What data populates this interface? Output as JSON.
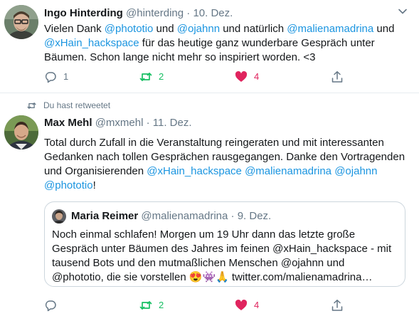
{
  "tweet1": {
    "name": "Ingo Hinterding",
    "handle": "@hinterding",
    "separator": "·",
    "date": "10. Dez.",
    "text": {
      "p1": "Vielen Dank ",
      "m1": "@phototio",
      "p2": " und ",
      "m2": "@ojahnn",
      "p3": " und natürlich ",
      "m3": "@malienamadrina",
      "p4": " und ",
      "m4": "@xHain_hackspace",
      "p5": " für das heutige ganz wunderbare Gespräch unter Bäumen. Schon lange nicht mehr so inspiriert worden. <3"
    },
    "actions": {
      "reply_count": "1",
      "retweet_count": "2",
      "like_count": "4"
    }
  },
  "tweet2": {
    "retweet_context": "Du hast retweetet",
    "name": "Max Mehl",
    "handle": "@mxmehl",
    "separator": "·",
    "date": "11. Dez.",
    "text": {
      "p1": "Total durch Zufall in die Veranstaltung reingeraten und mit interessanten Gedanken nach tollen Gesprächen rausgegangen. Danke den Vortragenden und Organisierenden ",
      "m1": "@xHain_hackspace",
      "p2": " ",
      "m2": "@malienamadrina",
      "p3": " ",
      "m3": "@ojahnn",
      "p4": " ",
      "m4": "@phototio",
      "p5": "!"
    },
    "quote": {
      "name": "Maria Reimer",
      "handle": "@malienamadrina",
      "separator": "·",
      "date": "9. Dez.",
      "text": "Noch einmal schlafen! Morgen um 19 Uhr dann das letzte große Gespräch unter Bäumen des Jahres im feinen @xHain_hackspace - mit tausend Bots und den mutmaßlichen Menschen @ojahnn und @phototio, die sie vorstellen ",
      "emojis": [
        "😍",
        "👾",
        "🙏"
      ],
      "link": "twitter.com/malienamadrina…"
    },
    "actions": {
      "reply_count": "",
      "retweet_count": "2",
      "like_count": "4"
    }
  },
  "icons": {
    "reply": "reply-icon",
    "retweet": "retweet-icon",
    "like": "heart-icon",
    "share": "share-icon",
    "caret": "chevron-down-icon"
  },
  "colors": {
    "mention": "#1b95e0",
    "retweet_active": "#17bf63",
    "like_active": "#e0245e",
    "muted": "#657786",
    "border": "#e6ecf0"
  }
}
